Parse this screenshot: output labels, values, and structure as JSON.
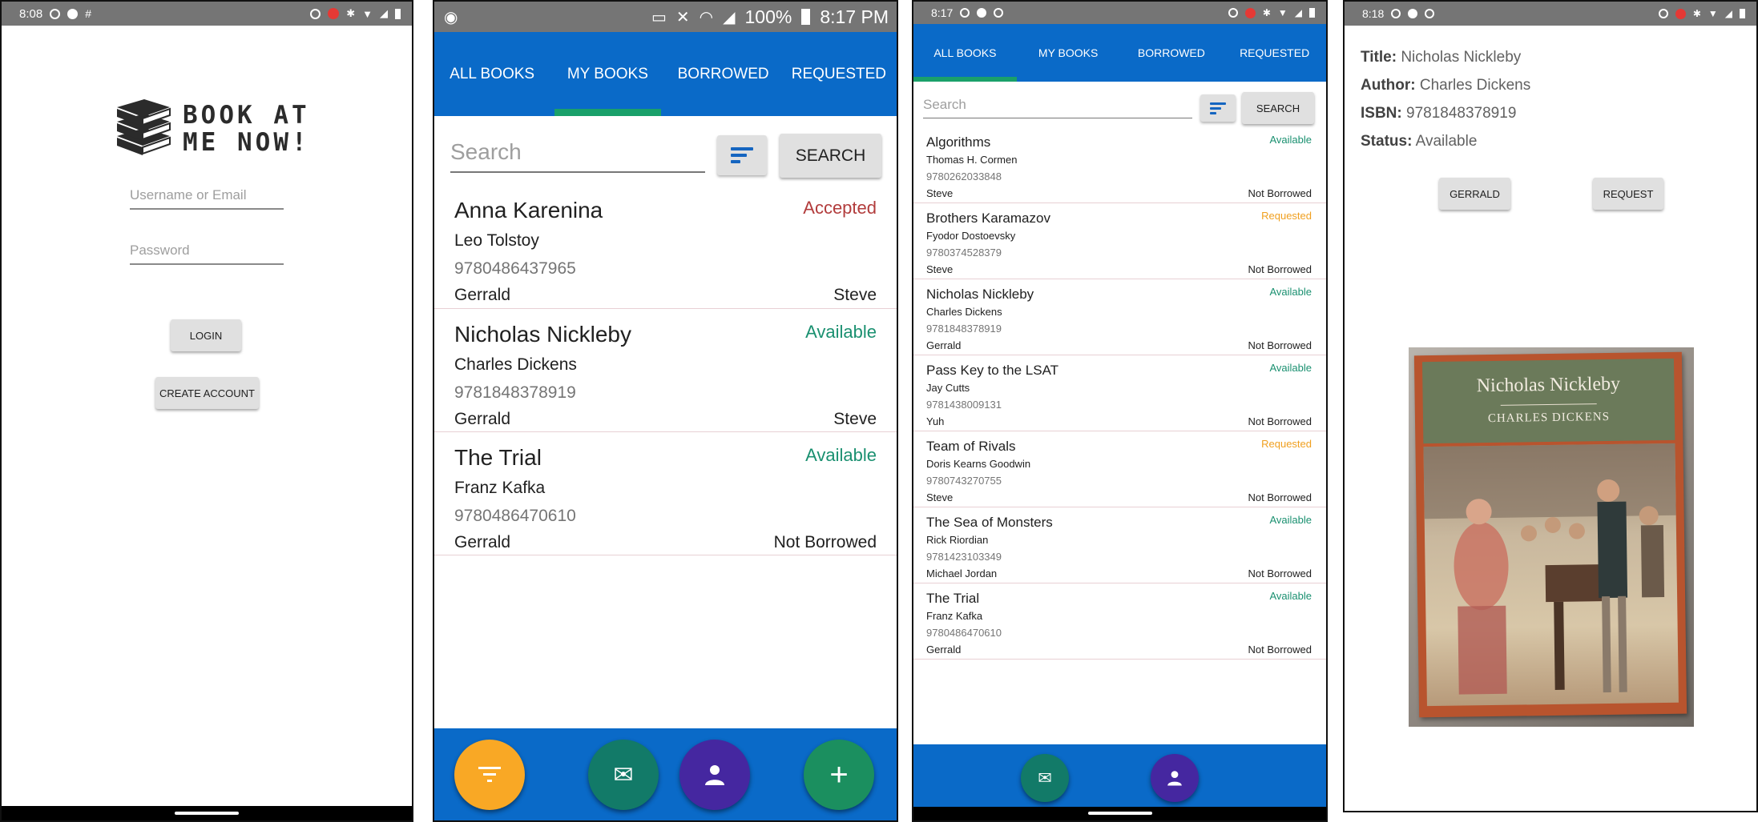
{
  "colors": {
    "accent_blue": "#0a6ac8",
    "tab_indicator": "#1aa06a",
    "status_accepted": "#b23c3c",
    "status_available": "#1a9070",
    "status_requested": "#f0a020",
    "fab_orange": "#f9a825",
    "fab_teal": "#127a68",
    "fab_purple": "#4527a0",
    "fab_green": "#1b8f5f"
  },
  "screen1": {
    "time": "8:08",
    "logo_line1": "BOOK AT",
    "logo_line2": "ME NOW!",
    "username_placeholder": "Username or Email",
    "password_placeholder": "Password",
    "login_label": "LOGIN",
    "create_label": "CREATE ACCOUNT"
  },
  "screen2": {
    "battery": "100%",
    "time": "8:17 PM",
    "tabs": [
      "ALL BOOKS",
      "MY BOOKS",
      "BORROWED",
      "REQUESTED"
    ],
    "search_placeholder": "Search",
    "search_label": "SEARCH",
    "books": [
      {
        "title": "Anna Karenina",
        "status": "Accepted",
        "author": "Leo Tolstoy",
        "isbn": "9780486437965",
        "owner": "Gerrald",
        "borrower": "Steve"
      },
      {
        "title": "Nicholas Nickleby",
        "status": "Available",
        "author": "Charles Dickens",
        "isbn": "9781848378919",
        "owner": "Gerrald",
        "borrower": "Steve"
      },
      {
        "title": "The Trial",
        "status": "Available",
        "author": "Franz Kafka",
        "isbn": "9780486470610",
        "owner": "Gerrald",
        "borrower": "Not Borrowed"
      }
    ],
    "fabs": [
      "filter-icon",
      "mail-icon",
      "person-icon",
      "plus-icon"
    ]
  },
  "screen3": {
    "time": "8:17",
    "tabs": [
      "ALL BOOKS",
      "MY BOOKS",
      "BORROWED",
      "REQUESTED"
    ],
    "search_placeholder": "Search",
    "search_label": "SEARCH",
    "books": [
      {
        "title": "Algorithms",
        "status": "Available",
        "author": "Thomas H. Cormen",
        "isbn": "9780262033848",
        "owner": "Steve",
        "borrower": "Not Borrowed"
      },
      {
        "title": "Brothers Karamazov",
        "status": "Requested",
        "author": "Fyodor Dostoevsky",
        "isbn": "9780374528379",
        "owner": "Steve",
        "borrower": "Not Borrowed"
      },
      {
        "title": "Nicholas Nickleby",
        "status": "Available",
        "author": "Charles Dickens",
        "isbn": "9781848378919",
        "owner": "Gerrald",
        "borrower": "Not Borrowed"
      },
      {
        "title": "Pass Key to the LSAT",
        "status": "Available",
        "author": "Jay Cutts",
        "isbn": "9781438009131",
        "owner": "Yuh",
        "borrower": "Not Borrowed"
      },
      {
        "title": "Team of Rivals",
        "status": "Requested",
        "author": "Doris Kearns Goodwin",
        "isbn": "9780743270755",
        "owner": "Steve",
        "borrower": "Not Borrowed"
      },
      {
        "title": "The Sea of Monsters",
        "status": "Available",
        "author": "Rick Riordian",
        "isbn": "9781423103349",
        "owner": "Michael Jordan",
        "borrower": "Not Borrowed"
      },
      {
        "title": "The Trial",
        "status": "Available",
        "author": "Franz Kafka",
        "isbn": "9780486470610",
        "owner": "Gerrald",
        "borrower": "Not Borrowed"
      }
    ]
  },
  "screen4": {
    "time": "8:18",
    "title_label": "Title:",
    "title_value": "Nicholas Nickleby",
    "author_label": "Author:",
    "author_value": "Charles Dickens",
    "isbn_label": "ISBN:",
    "isbn_value": "9781848378919",
    "status_label": "Status:",
    "status_value": "Available",
    "owner_button": "GERRALD",
    "request_button": "REQUEST",
    "cover_title": "Nicholas Nickleby",
    "cover_author": "CHARLES DICKENS"
  }
}
